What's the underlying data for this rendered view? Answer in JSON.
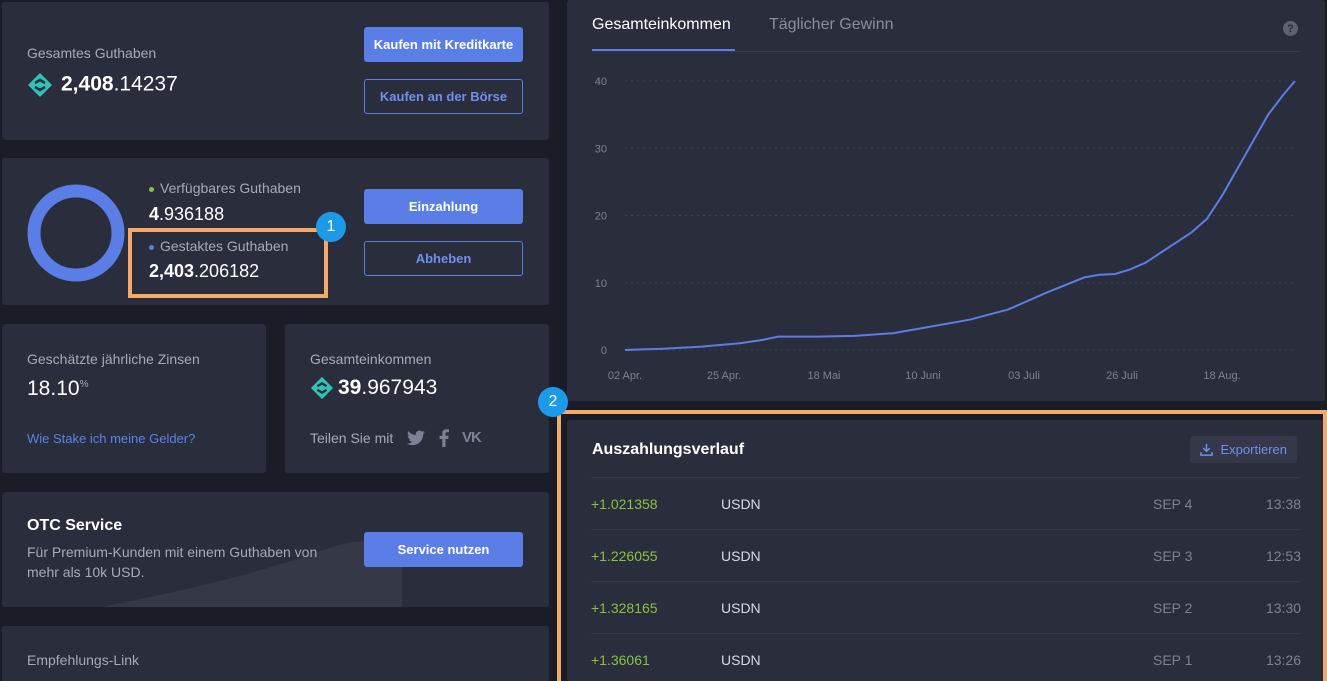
{
  "balance": {
    "label": "Gesamtes Guthaben",
    "int": "2,408",
    "frac": ".14237",
    "btn_credit": "Kaufen mit Kreditkarte",
    "btn_exchange": "Kaufen an der Börse"
  },
  "staking": {
    "available_label": "Verfügbares Guthaben",
    "available_int": "4",
    "available_frac": ".936188",
    "staked_label": "Gestaktes Guthaben",
    "staked_int": "2,403",
    "staked_frac": ".206182",
    "btn_deposit": "Einzahlung",
    "btn_withdraw": "Abheben",
    "donut_color": "#5b7ee6",
    "available_dot": "#86c340",
    "staked_dot": "#5b7ee6"
  },
  "interest": {
    "label": "Geschätzte jährliche Zinsen",
    "value": "18.10",
    "unit": "%",
    "link": "Wie Stake ich meine Gelder?"
  },
  "income": {
    "label": "Gesamteinkommen",
    "int": "39",
    "frac": ".967943",
    "share_label": "Teilen Sie mit",
    "share_icons": [
      "twitter-icon",
      "facebook-icon",
      "vk-icon"
    ]
  },
  "otc": {
    "title": "OTC Service",
    "desc_line1": "Für Premium-Kunden mit einem Guthaben von",
    "desc_line2": "mehr als 10k USD.",
    "btn": "Service nutzen"
  },
  "referral": {
    "label": "Empfehlungs-Link"
  },
  "chart_tabs": {
    "active": "Gesamteinkommen",
    "inactive": "Täglicher Gewinn",
    "help": "?"
  },
  "chart_data": {
    "type": "line",
    "title": "",
    "xlabel": "",
    "ylabel": "",
    "ylim": [
      0,
      40
    ],
    "yticks": [
      "0",
      "10",
      "20",
      "30",
      "40"
    ],
    "xticks": [
      "02 Apr.",
      "25 Apr.",
      "18 Mai",
      "10 Juni",
      "03 Juli",
      "26 Juli",
      "18 Aug."
    ],
    "x_range_days": [
      0,
      152
    ],
    "grid": true,
    "color": "#5b7ee6",
    "points": [
      [
        0,
        0
      ],
      [
        10,
        0.2
      ],
      [
        20,
        0.5
      ],
      [
        30,
        1
      ],
      [
        36,
        1.5
      ],
      [
        40,
        2
      ],
      [
        50,
        2
      ],
      [
        60,
        2.1
      ],
      [
        70,
        2.5
      ],
      [
        80,
        3.5
      ],
      [
        90,
        4.5
      ],
      [
        100,
        6
      ],
      [
        110,
        8.5
      ],
      [
        120,
        10.8
      ],
      [
        124,
        11.2
      ],
      [
        128,
        11.3
      ],
      [
        132,
        12
      ],
      [
        136,
        13
      ],
      [
        140,
        14.5
      ],
      [
        144,
        16
      ],
      [
        148,
        17.5
      ],
      [
        152,
        19.5
      ],
      [
        156,
        23
      ],
      [
        160,
        27
      ],
      [
        164,
        31
      ],
      [
        168,
        35
      ],
      [
        172,
        38
      ],
      [
        175,
        40
      ]
    ]
  },
  "payouts": {
    "title": "Auszahlungsverlauf",
    "export": "Exportieren",
    "rows": [
      {
        "amount": "+1.021358",
        "currency": "USDN",
        "date": "SEP 4",
        "time": "13:38"
      },
      {
        "amount": "+1.226055",
        "currency": "USDN",
        "date": "SEP 3",
        "time": "12:53"
      },
      {
        "amount": "+1.328165",
        "currency": "USDN",
        "date": "SEP 2",
        "time": "13:30"
      },
      {
        "amount": "+1.36061",
        "currency": "USDN",
        "date": "SEP 1",
        "time": "13:26"
      }
    ]
  },
  "annotations": {
    "badge1": "1",
    "badge2": "2",
    "highlight_color": "#f5a968",
    "badge_color": "#1c9ae8"
  }
}
